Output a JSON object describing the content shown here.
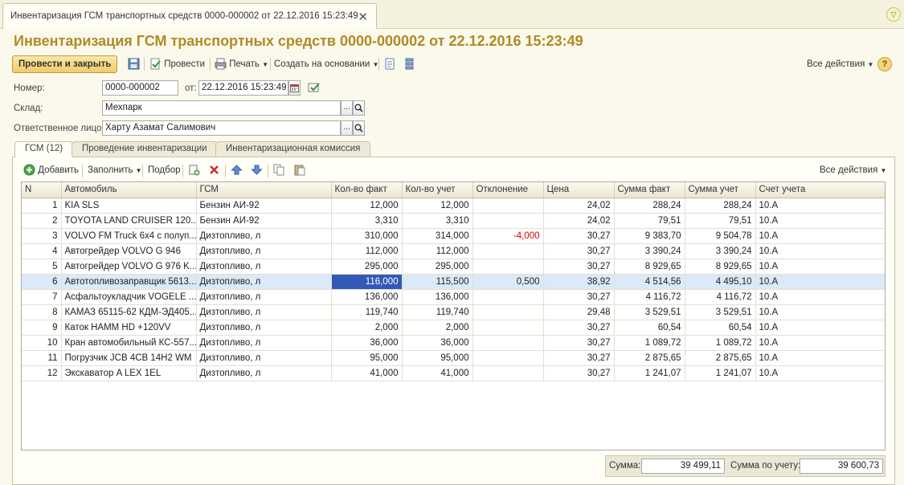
{
  "window": {
    "tab_title": "Инвентаризация ГСМ транспортных средств 0000-000002 от 22.12.2016 15:23:49",
    "close_glyph": "✕",
    "corner_glyph": "▽"
  },
  "doc_title": "Инвентаризация ГСМ транспортных средств 0000-000002 от 22.12.2016 15:23:49",
  "toolbar": {
    "post_close": "Провести и закрыть",
    "post": "Провести",
    "print": "Печать",
    "create_based": "Создать на основании",
    "all_actions": "Все действия",
    "help": "?"
  },
  "form": {
    "number_label": "Номер:",
    "number": "0000-000002",
    "date_label": "от:",
    "date": "22.12.2016 15:23:49",
    "warehouse_label": "Склад:",
    "warehouse": "Мехпарк",
    "responsible_label": "Ответственное лицо:",
    "responsible": "Харту Азамат Салимович",
    "select_glyph": "...",
    "search_glyph": "⚲"
  },
  "tabs": [
    "ГСМ (12)",
    "Проведение инвентаризации",
    "Инвентаризационная комиссия"
  ],
  "grid_toolbar": {
    "add": "Добавить",
    "fill": "Заполнить",
    "pick": "Подбор",
    "all_actions": "Все действия"
  },
  "columns": [
    "N",
    "Автомобиль",
    "ГСМ",
    "Кол-во факт",
    "Кол-во учет",
    "Отклонение",
    "Цена",
    "Сумма факт",
    "Сумма учет",
    "Счет учета"
  ],
  "rows": [
    {
      "n": "1",
      "car": "KIA SLS",
      "fuel": "Бензин АИ-92",
      "qf": "12,000",
      "qu": "12,000",
      "dev": "",
      "price": "24,02",
      "sf": "288,24",
      "su": "288,24",
      "acc": "10.А"
    },
    {
      "n": "2",
      "car": "TOYOTA LAND CRUISER 120...",
      "fuel": "Бензин АИ-92",
      "qf": "3,310",
      "qu": "3,310",
      "dev": "",
      "price": "24,02",
      "sf": "79,51",
      "su": "79,51",
      "acc": "10.А"
    },
    {
      "n": "3",
      "car": "VOLVO FM Truck 6x4 с полуп...",
      "fuel": "Дизтопливо, л",
      "qf": "310,000",
      "qu": "314,000",
      "dev": "-4,000",
      "price": "30,27",
      "sf": "9 383,70",
      "su": "9 504,78",
      "acc": "10.А"
    },
    {
      "n": "4",
      "car": "Автогрейдер VOLVO G 946",
      "fuel": "Дизтопливо, л",
      "qf": "112,000",
      "qu": "112,000",
      "dev": "",
      "price": "30,27",
      "sf": "3 390,24",
      "su": "3 390,24",
      "acc": "10.А"
    },
    {
      "n": "5",
      "car": "Автогрейдер VOLVO G 976 K...",
      "fuel": "Дизтопливо, л",
      "qf": "295,000",
      "qu": "295,000",
      "dev": "",
      "price": "30,27",
      "sf": "8 929,65",
      "su": "8 929,65",
      "acc": "10.А"
    },
    {
      "n": "6",
      "car": "Автотопливозаправщик 5613...",
      "fuel": "Дизтопливо, л",
      "qf": "116,000",
      "qu": "115,500",
      "dev": "0,500",
      "price": "38,92",
      "sf": "4 514,56",
      "su": "4 495,10",
      "acc": "10.А"
    },
    {
      "n": "7",
      "car": "Асфальтоукладчик VOGELE ...",
      "fuel": "Дизтопливо, л",
      "qf": "136,000",
      "qu": "136,000",
      "dev": "",
      "price": "30,27",
      "sf": "4 116,72",
      "su": "4 116,72",
      "acc": "10.А"
    },
    {
      "n": "8",
      "car": "КАМАЗ 65115-62 КДМ-ЭД405...",
      "fuel": "Дизтопливо, л",
      "qf": "119,740",
      "qu": "119,740",
      "dev": "",
      "price": "29,48",
      "sf": "3 529,51",
      "su": "3 529,51",
      "acc": "10.А"
    },
    {
      "n": "9",
      "car": "Каток HAMM HD +120VV",
      "fuel": "Дизтопливо, л",
      "qf": "2,000",
      "qu": "2,000",
      "dev": "",
      "price": "30,27",
      "sf": "60,54",
      "su": "60,54",
      "acc": "10.А"
    },
    {
      "n": "10",
      "car": "Кран автомобильный КС-557...",
      "fuel": "Дизтопливо, л",
      "qf": "36,000",
      "qu": "36,000",
      "dev": "",
      "price": "30,27",
      "sf": "1 089,72",
      "su": "1 089,72",
      "acc": "10.А"
    },
    {
      "n": "11",
      "car": "Погрузчик JCB 4CB 14H2 WM",
      "fuel": "Дизтопливо, л",
      "qf": "95,000",
      "qu": "95,000",
      "dev": "",
      "price": "30,27",
      "sf": "2 875,65",
      "su": "2 875,65",
      "acc": "10.А"
    },
    {
      "n": "12",
      "car": "Экскаватор A LEX 1EL",
      "fuel": "Дизтопливо, л",
      "qf": "41,000",
      "qu": "41,000",
      "dev": "",
      "price": "30,27",
      "sf": "1 241,07",
      "su": "1 241,07",
      "acc": "10.А"
    }
  ],
  "footer": {
    "sum_label": "Сумма:",
    "sum": "39 499,11",
    "sum_acc_label": "Сумма по учету:",
    "sum_acc": "39 600,73"
  }
}
